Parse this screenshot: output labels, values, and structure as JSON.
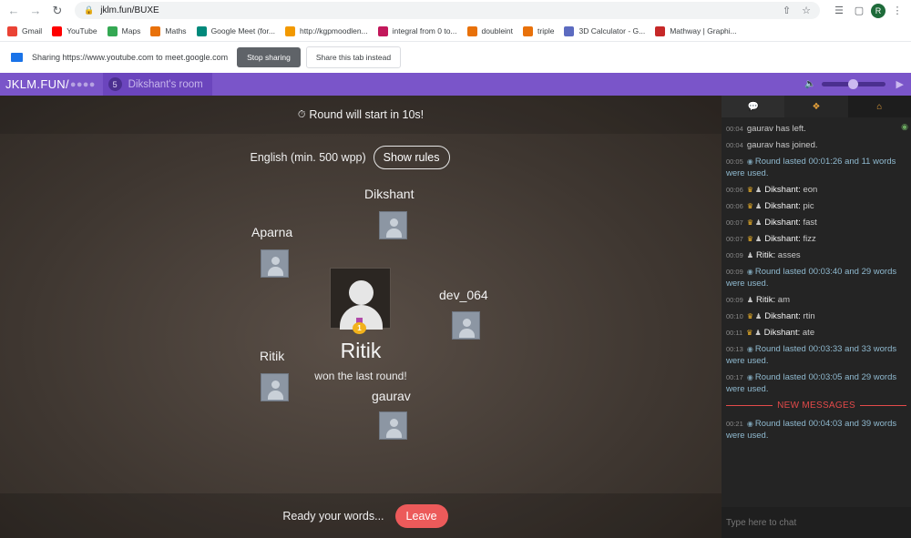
{
  "browser": {
    "url": "jklm.fun/BUXE",
    "profile_initial": "R"
  },
  "bookmarks": [
    {
      "label": "Gmail",
      "color": "#ea4335",
      "icon": "gmail-icon"
    },
    {
      "label": "YouTube",
      "color": "#ff0000",
      "icon": "youtube-icon"
    },
    {
      "label": "Maps",
      "color": "#34a853",
      "icon": "maps-icon"
    },
    {
      "label": "Maths",
      "color": "#e8710a",
      "icon": "settings-icon"
    },
    {
      "label": "Google Meet (for...",
      "color": "#00897b",
      "icon": "meet-icon"
    },
    {
      "label": "http://kgpmoodlen...",
      "color": "#f29900",
      "icon": "moodle-icon"
    },
    {
      "label": "integral from 0 to...",
      "color": "#c2185b",
      "icon": "symbolab-icon"
    },
    {
      "label": "doubleint",
      "color": "#e8710a",
      "icon": "settings-icon"
    },
    {
      "label": "triple",
      "color": "#e8710a",
      "icon": "settings-icon"
    },
    {
      "label": "3D Calculator - G...",
      "color": "#5c6bc0",
      "icon": "geogebra-icon"
    },
    {
      "label": "Mathway | Graphi...",
      "color": "#c62828",
      "icon": "mathway-icon"
    }
  ],
  "sharebar": {
    "text": "Sharing https://www.youtube.com to meet.google.com",
    "stop_label": "Stop sharing",
    "share_tab_label": "Share this tab instead"
  },
  "room": {
    "brand": "JKLM.FUN/",
    "code": "●●●●",
    "number": "5",
    "name": "Dikshant's room",
    "volume": 0.5
  },
  "game": {
    "round_banner": "Round will start in 10s!",
    "language": "English (min. 500 wpp)",
    "rules_label": "Show rules",
    "players": [
      "Dikshant",
      "Aparna",
      "dev_064",
      "Ritik",
      "gaurav"
    ],
    "winner": "Ritik",
    "winner_medal": "1",
    "winner_sub": "won the last round!",
    "ready_text": "Ready your words...",
    "leave_label": "Leave"
  },
  "chat": {
    "tabs": [
      "chat-icon",
      "puzzle-icon",
      "home-icon"
    ],
    "messages": [
      {
        "ts": "00:04",
        "type": "plain",
        "text": "gaurav has left."
      },
      {
        "ts": "00:04",
        "type": "plain",
        "text": "gaurav has joined."
      },
      {
        "ts": "00:05",
        "type": "sys",
        "text": "Round lasted 00:01:26 and 11 words were used."
      },
      {
        "ts": "00:06",
        "type": "word",
        "speaker": "Dikshant:",
        "text": "eon"
      },
      {
        "ts": "00:06",
        "type": "word",
        "speaker": "Dikshant:",
        "text": "pic"
      },
      {
        "ts": "00:07",
        "type": "word",
        "speaker": "Dikshant:",
        "text": "fast"
      },
      {
        "ts": "00:07",
        "type": "word",
        "speaker": "Dikshant:",
        "text": "fizz"
      },
      {
        "ts": "00:09",
        "type": "user",
        "speaker": "Ritik:",
        "text": "asses"
      },
      {
        "ts": "00:09",
        "type": "sys",
        "text": "Round lasted 00:03:40 and 29 words were used."
      },
      {
        "ts": "00:09",
        "type": "user",
        "speaker": "Ritik:",
        "text": "am"
      },
      {
        "ts": "00:10",
        "type": "word",
        "speaker": "Dikshant:",
        "text": "rtin"
      },
      {
        "ts": "00:11",
        "type": "word",
        "speaker": "Dikshant:",
        "text": "ate"
      },
      {
        "ts": "00:13",
        "type": "sys",
        "text": "Round lasted 00:03:33 and 33 words were used."
      },
      {
        "ts": "00:17",
        "type": "sys",
        "text": "Round lasted 00:03:05 and 29 words were used."
      }
    ],
    "new_messages_label": "NEW MESSAGES",
    "new_messages": [
      {
        "ts": "00:21",
        "type": "sys",
        "text": "Round lasted 00:04:03 and 39 words were used."
      }
    ],
    "input_placeholder": "Type here to chat"
  }
}
